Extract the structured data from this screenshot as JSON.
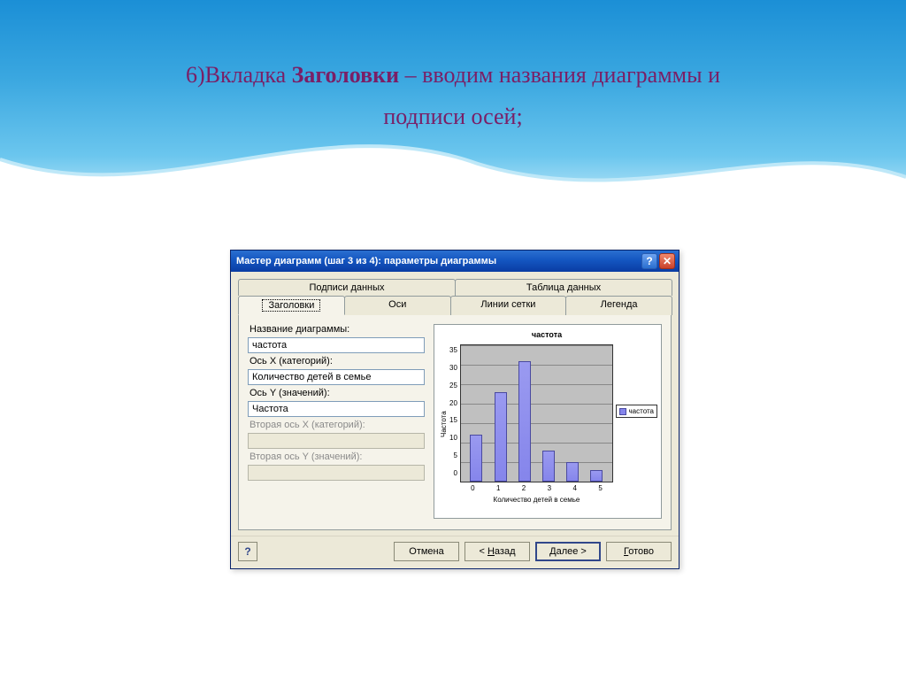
{
  "slide": {
    "title_pre": "6)Вкладка ",
    "title_bold": "Заголовки",
    "title_post": " – вводим названия диаграммы и",
    "title_line2": "подписи осей;"
  },
  "dialog": {
    "title": "Мастер диаграмм (шаг 3 из 4): параметры диаграммы",
    "tabs_top": [
      "Подписи данных",
      "Таблица данных"
    ],
    "tabs_bottom": [
      "Заголовки",
      "Оси",
      "Линии сетки",
      "Легенда"
    ],
    "active_tab": "Заголовки",
    "labels": {
      "chart_title": "Название диаграммы:",
      "axis_x": "Ось X (категорий):",
      "axis_y": "Ось Y (значений):",
      "axis_x2": "Вторая ось X (категорий):",
      "axis_y2": "Вторая ось Y (значений):"
    },
    "values": {
      "chart_title": "частота",
      "axis_x": "Количество детей в семье",
      "axis_y": "Частота",
      "axis_x2": "",
      "axis_y2": ""
    },
    "buttons": {
      "cancel": "Отмена",
      "back": "< Назад",
      "next": "Далее >",
      "finish": "Готово"
    }
  },
  "chart_data": {
    "type": "bar",
    "title": "частота",
    "xlabel": "Количество детей в семье",
    "ylabel": "Частота",
    "categories": [
      "0",
      "1",
      "2",
      "3",
      "4",
      "5"
    ],
    "values": [
      12,
      23,
      31,
      8,
      5,
      3
    ],
    "ylim": [
      0,
      35
    ],
    "yticks": [
      0,
      5,
      10,
      15,
      20,
      25,
      30,
      35
    ],
    "legend": "частота"
  }
}
